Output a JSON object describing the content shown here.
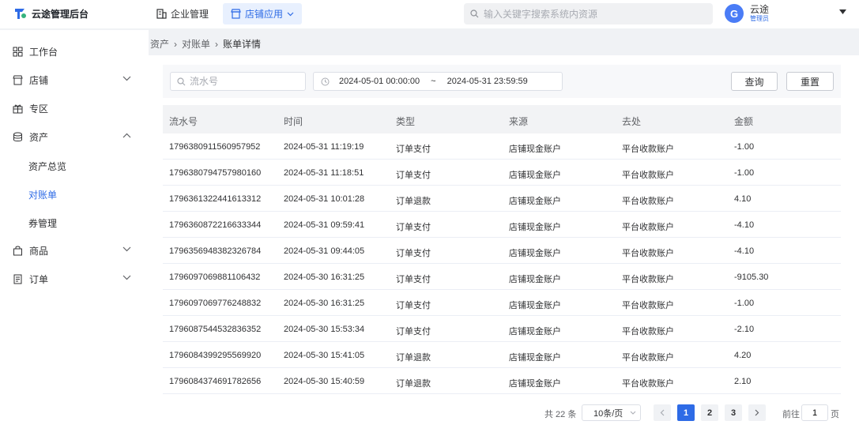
{
  "app": {
    "title": "云途管理后台"
  },
  "topnav": [
    {
      "label": "企业管理",
      "icon": "building-icon"
    },
    {
      "label": "店铺应用",
      "icon": "store-icon"
    }
  ],
  "search": {
    "placeholder": "输入关键字搜索系统内资源"
  },
  "user": {
    "avatar_letter": "G",
    "name": "云途",
    "role": "管理员"
  },
  "sidebar": {
    "items": [
      {
        "label": "工作台"
      },
      {
        "label": "店铺"
      },
      {
        "label": "专区"
      },
      {
        "label": "资产"
      },
      {
        "label": "商品"
      },
      {
        "label": "订单"
      }
    ],
    "sub_items": [
      {
        "label": "资产总览"
      },
      {
        "label": "对账单"
      },
      {
        "label": "券管理"
      }
    ]
  },
  "breadcrumb": [
    "资产",
    "对账单",
    "账单详情"
  ],
  "filters": {
    "serial_placeholder": "流水号",
    "date_start": "2024-05-01 00:00:00",
    "date_sep": "~",
    "date_end": "2024-05-31 23:59:59",
    "query_label": "查询",
    "reset_label": "重置"
  },
  "table": {
    "headers": [
      "流水号",
      "时间",
      "类型",
      "来源",
      "去处",
      "金额"
    ],
    "rows": [
      [
        "1796380911560957952",
        "2024-05-31 11:19:19",
        "订单支付",
        "店铺现金账户",
        "平台收款账户",
        "-1.00"
      ],
      [
        "1796380794757980160",
        "2024-05-31 11:18:51",
        "订单支付",
        "店铺现金账户",
        "平台收款账户",
        "-1.00"
      ],
      [
        "1796361322441613312",
        "2024-05-31 10:01:28",
        "订单退款",
        "店铺现金账户",
        "平台收款账户",
        "4.10"
      ],
      [
        "1796360872216633344",
        "2024-05-31 09:59:41",
        "订单支付",
        "店铺现金账户",
        "平台收款账户",
        "-4.10"
      ],
      [
        "1796356948382326784",
        "2024-05-31 09:44:05",
        "订单支付",
        "店铺现金账户",
        "平台收款账户",
        "-4.10"
      ],
      [
        "1796097069881106432",
        "2024-05-30 16:31:25",
        "订单支付",
        "店铺现金账户",
        "平台收款账户",
        "-9105.30"
      ],
      [
        "1796097069776248832",
        "2024-05-30 16:31:25",
        "订单支付",
        "店铺现金账户",
        "平台收款账户",
        "-1.00"
      ],
      [
        "1796087544532836352",
        "2024-05-30 15:53:34",
        "订单支付",
        "店铺现金账户",
        "平台收款账户",
        "-2.10"
      ],
      [
        "1796084399295569920",
        "2024-05-30 15:41:05",
        "订单退款",
        "店铺现金账户",
        "平台收款账户",
        "4.20"
      ],
      [
        "1796084374691782656",
        "2024-05-30 15:40:59",
        "订单退款",
        "店铺现金账户",
        "平台收款账户",
        "2.10"
      ]
    ]
  },
  "pagination": {
    "total": "共 22 条",
    "page_size": "10条/页",
    "pages": [
      "1",
      "2",
      "3"
    ],
    "current": "1",
    "goto_label": "前往",
    "goto_value": "1",
    "page_label": "页"
  },
  "colors": {
    "accent": "#2e6be6",
    "avatar": "#4a7cf6"
  }
}
